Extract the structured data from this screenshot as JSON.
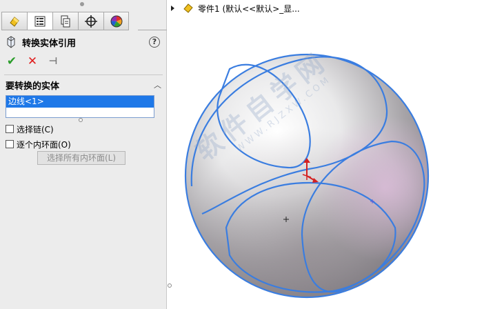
{
  "panel": {
    "tabs": [
      {
        "name": "feature-manager-tab",
        "icon": "feature-manager-icon"
      },
      {
        "name": "property-manager-tab",
        "icon": "property-manager-icon"
      },
      {
        "name": "configuration-manager-tab",
        "icon": "configuration-manager-icon"
      },
      {
        "name": "dimxpert-manager-tab",
        "icon": "crosshair-icon"
      },
      {
        "name": "display-manager-tab",
        "icon": "color-wheel-icon"
      }
    ],
    "title": "转换实体引用",
    "help_icon_glyph": "?",
    "actions": {
      "ok_glyph": "✔",
      "cancel_glyph": "✕",
      "pin_glyph": "⊣"
    },
    "group": {
      "title": "要转换的实体",
      "collapse_glyph": "︿",
      "selected_item": "边线<1>"
    },
    "options": {
      "select_chain": "选择链(C)",
      "inner_loops": "逐个内环面(O)",
      "select_all_button": "选择所有内环面(L)"
    }
  },
  "tree": {
    "root_label": "零件1  (默认<<默认>_显..."
  },
  "watermark": {
    "text": "软件自学网",
    "sub": "WWW.RJZXW.COM"
  },
  "colors": {
    "edge_blue": "#3a7de0",
    "selection_blue": "#1e78e8",
    "ok_green": "#2a9d2a",
    "cancel_red": "#e01e1e"
  }
}
